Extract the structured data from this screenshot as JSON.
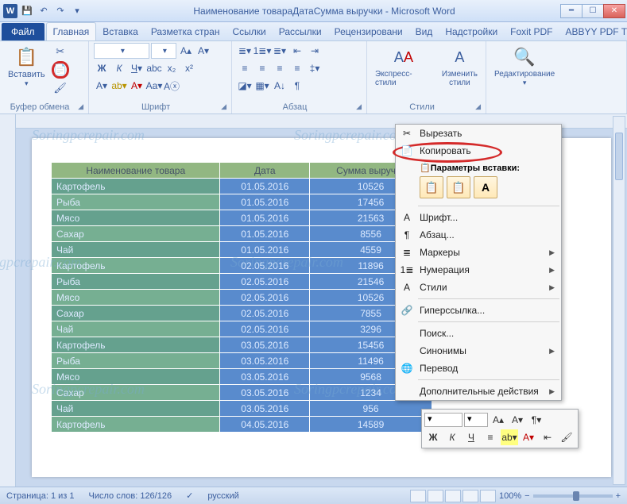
{
  "title": "Наименование товараДатаСумма выручки  -  Microsoft Word",
  "tabs": {
    "file": "Файл",
    "items": [
      "Главная",
      "Вставка",
      "Разметка стран",
      "Ссылки",
      "Рассылки",
      "Рецензировани",
      "Вид",
      "Надстройки",
      "Foxit PDF",
      "ABBYY PDF Trans"
    ],
    "active_index": 0
  },
  "ribbon": {
    "clipboard": {
      "label": "Буфер обмена",
      "paste": "Вставить"
    },
    "font": {
      "label": "Шрифт"
    },
    "paragraph": {
      "label": "Абзац"
    },
    "styles": {
      "label": "Стили",
      "quick": "Экспресс-стили",
      "change": "Изменить\nстили"
    },
    "editing": {
      "label": "Редактирование"
    }
  },
  "table": {
    "headers": [
      "Наименование товара",
      "Дата",
      "Сумма выручки"
    ],
    "rows": [
      [
        "Картофель",
        "01.05.2016",
        "10526"
      ],
      [
        "Рыба",
        "01.05.2016",
        "17456"
      ],
      [
        "Мясо",
        "01.05.2016",
        "21563"
      ],
      [
        "Сахар",
        "01.05.2016",
        "8556"
      ],
      [
        "Чай",
        "01.05.2016",
        "4559"
      ],
      [
        "Картофель",
        "02.05.2016",
        "11896"
      ],
      [
        "Рыба",
        "02.05.2016",
        "21546"
      ],
      [
        "Мясо",
        "02.05.2016",
        "10526"
      ],
      [
        "Сахар",
        "02.05.2016",
        "7855"
      ],
      [
        "Чай",
        "02.05.2016",
        "3296"
      ],
      [
        "Картофель",
        "03.05.2016",
        "15456"
      ],
      [
        "Рыба",
        "03.05.2016",
        "11496"
      ],
      [
        "Мясо",
        "03.05.2016",
        "9568"
      ],
      [
        "Сахар",
        "03.05.2016",
        "1234"
      ],
      [
        "Чай",
        "03.05.2016",
        "956"
      ],
      [
        "Картофель",
        "04.05.2016",
        "14589"
      ]
    ]
  },
  "context_menu": {
    "cut": "Вырезать",
    "copy": "Копировать",
    "paste_header": "Параметры вставки:",
    "font": "Шрифт...",
    "paragraph": "Абзац...",
    "bullets": "Маркеры",
    "numbering": "Нумерация",
    "styles": "Стили",
    "hyperlink": "Гиперссылка...",
    "search": "Поиск...",
    "synonyms": "Синонимы",
    "translate": "Перевод",
    "additional": "Дополнительные действия"
  },
  "status": {
    "page": "Страница: 1 из 1",
    "words": "Число слов: 126/126",
    "lang": "русский",
    "zoom": "100%"
  },
  "watermark": "Soringpcrepair.com"
}
